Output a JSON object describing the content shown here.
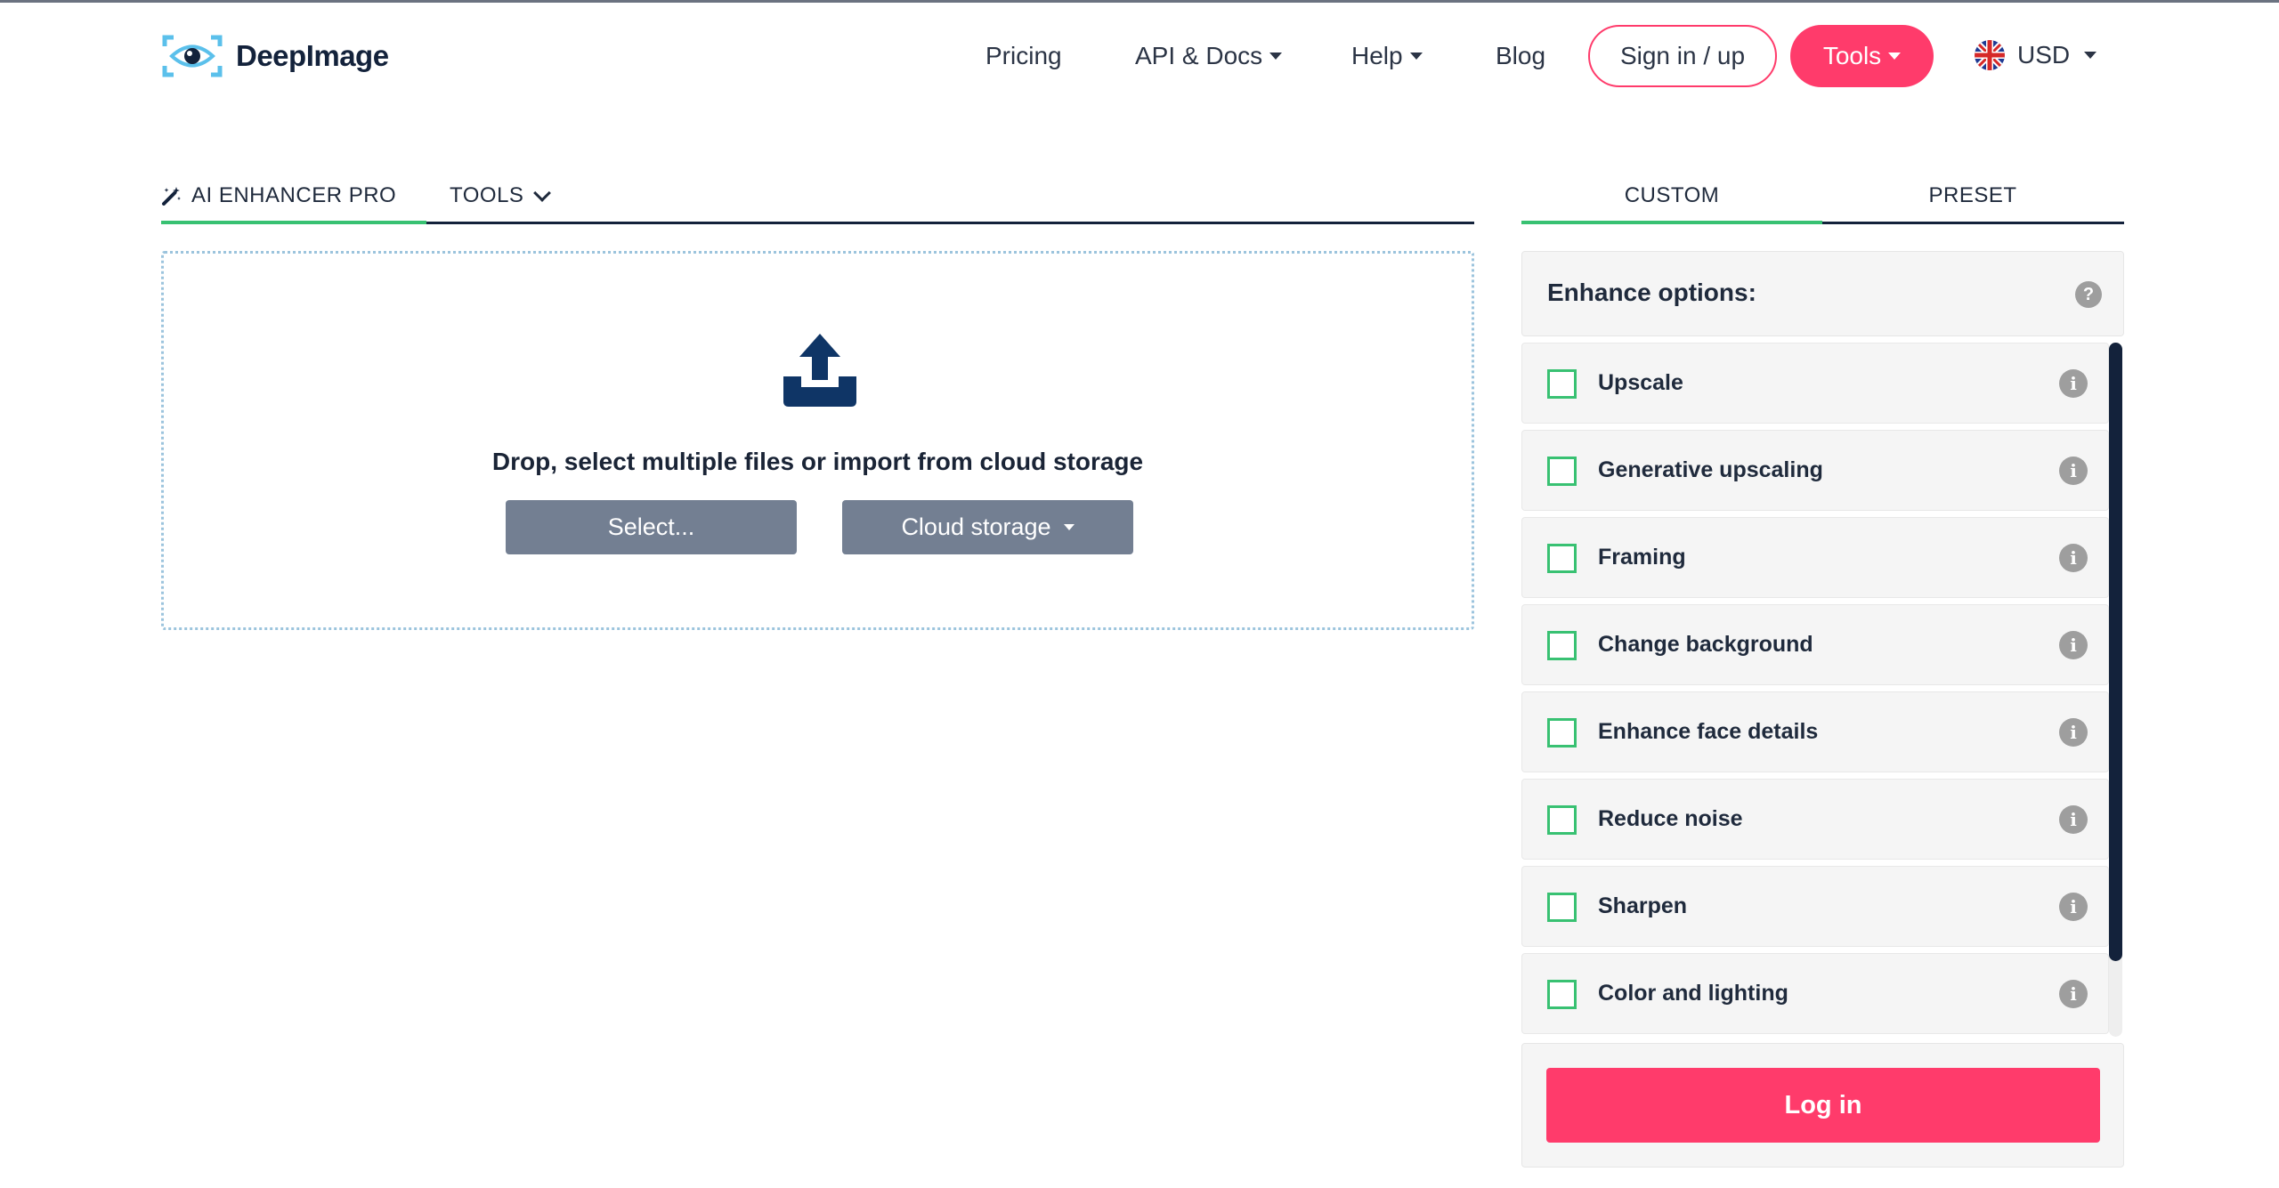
{
  "header": {
    "brand": "DeepImage",
    "nav": {
      "pricing": "Pricing",
      "api_docs": "API & Docs",
      "help": "Help",
      "blog": "Blog"
    },
    "signin_label": "Sign in / up",
    "tools_label": "Tools",
    "currency": "USD"
  },
  "left_tabs": {
    "active": "AI ENHANCER PRO",
    "tools": "TOOLS"
  },
  "dropzone": {
    "text": "Drop, select multiple files or import from cloud storage",
    "select_label": "Select...",
    "cloud_label": "Cloud storage"
  },
  "right_tabs": {
    "custom": "CUSTOM",
    "preset": "PRESET"
  },
  "options": {
    "title": "Enhance options:",
    "items": [
      {
        "label": "Upscale",
        "checked": false
      },
      {
        "label": "Generative upscaling",
        "checked": false
      },
      {
        "label": "Framing",
        "checked": false
      },
      {
        "label": "Change background",
        "checked": false
      },
      {
        "label": "Enhance face details",
        "checked": false
      },
      {
        "label": "Reduce noise",
        "checked": false
      },
      {
        "label": "Sharpen",
        "checked": false
      },
      {
        "label": "Color and lighting",
        "checked": false
      }
    ]
  },
  "login_label": "Log in",
  "colors": {
    "accent": "#ff3b6b",
    "green": "#38c172",
    "navy": "#13223b"
  }
}
